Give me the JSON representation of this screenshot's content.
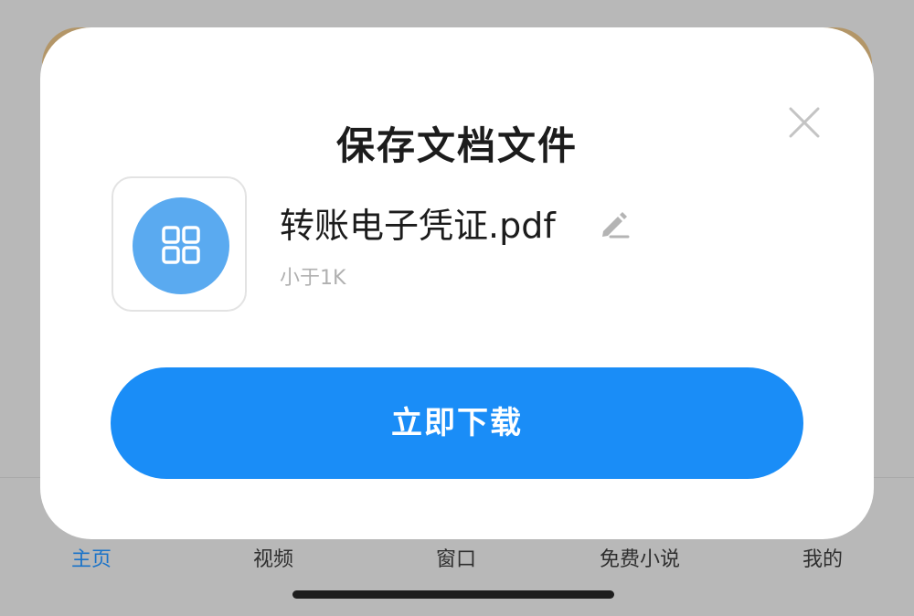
{
  "dialog": {
    "title": "保存文档文件",
    "file_name": "转账电子凭证.pdf",
    "file_size": "小于1K",
    "download_label": "立即下载",
    "close_icon": "close-icon",
    "edit_icon": "pencil-icon",
    "file_icon": "grid-apps-icon"
  },
  "tabbar": {
    "items": [
      {
        "label": "主页",
        "active": true
      },
      {
        "label": "视频",
        "active": false
      },
      {
        "label": "窗口",
        "active": false
      },
      {
        "label": "免费小说",
        "active": false
      },
      {
        "label": "我的",
        "active": false
      }
    ]
  },
  "colors": {
    "accent": "#1a8df7",
    "active_tab": "#1a73c9",
    "file_icon_bg": "#5aaaf0",
    "overlay": "#b8b8b8"
  }
}
